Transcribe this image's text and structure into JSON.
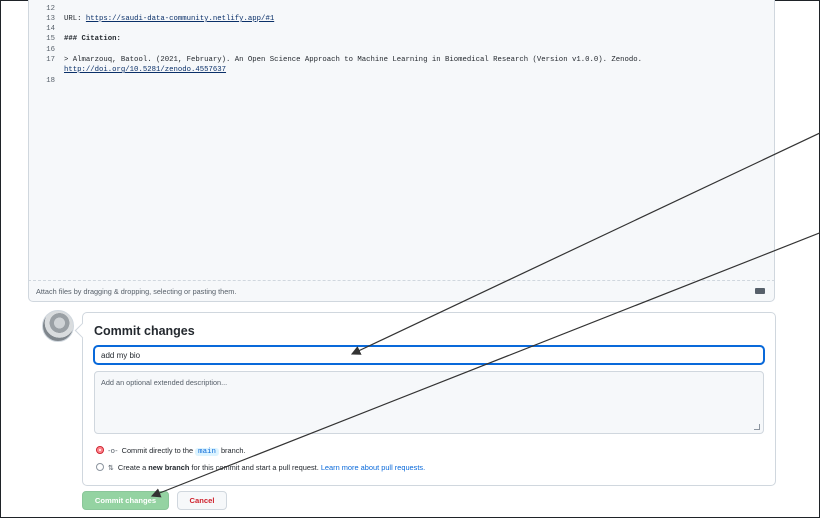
{
  "editor": {
    "lines": [
      {
        "num": "12",
        "text": ""
      },
      {
        "num": "13",
        "prefix": "URL: ",
        "link": "https://saudi-data-community.netlify.app/#1"
      },
      {
        "num": "14",
        "text": ""
      },
      {
        "num": "15",
        "text": "### Citation:"
      },
      {
        "num": "16",
        "text": ""
      },
      {
        "num": "17",
        "text": "> Almarzouq, Batool. (2021, February). An Open Science Approach to Machine Learning in Biomedical Research (Version v1.0.0). Zenodo.",
        "link2": "http://doi.org/10.5281/zenodo.4557637"
      },
      {
        "num": "18",
        "text": ""
      }
    ],
    "attach_text": "Attach files by dragging & dropping, selecting or pasting them.",
    "markdown_icon": "markdown-icon"
  },
  "commit": {
    "title": "Commit changes",
    "summary_value": "add my bio",
    "description_placeholder": "Add an optional extended description...",
    "option_direct": {
      "icon": "git-commit-icon",
      "glyph": "-o-",
      "before": "Commit directly to the ",
      "branch": "main",
      "after": " branch."
    },
    "option_new": {
      "icon": "git-pull-request-icon",
      "glyph": "⇅",
      "before": "Create a ",
      "bold": "new branch",
      "middle": " for this commit and start a pull request. ",
      "link": "Learn more about pull requests."
    },
    "commit_button": "Commit changes",
    "cancel_button": "Cancel"
  },
  "colors": {
    "commit_button_bg": "#94d3a2",
    "cancel_text": "#cf222e",
    "link": "#0969da",
    "focus_border": "#0969da"
  }
}
